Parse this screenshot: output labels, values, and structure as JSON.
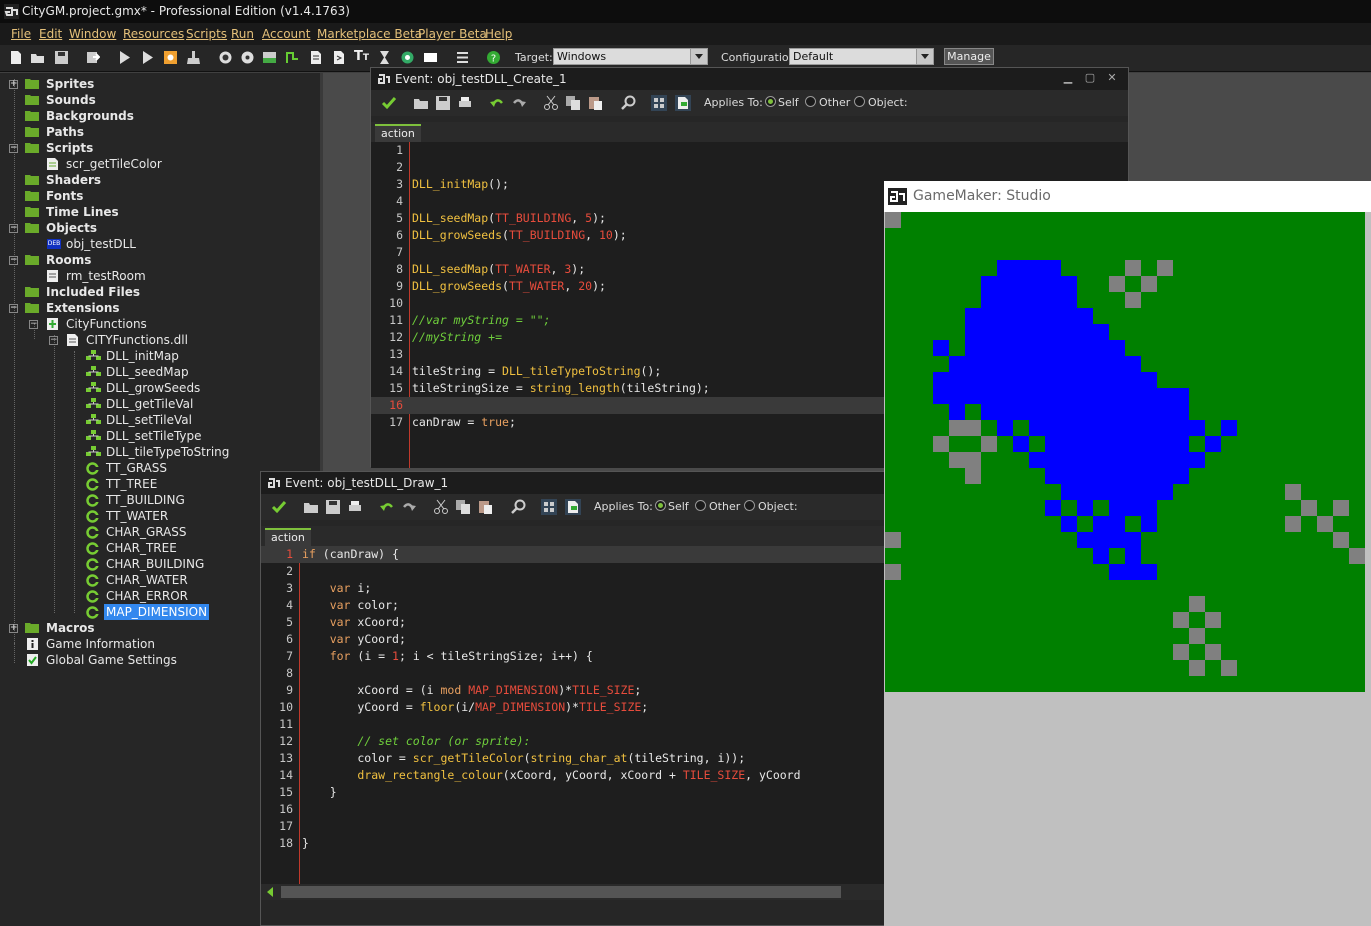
{
  "window": {
    "title": "CityGM.project.gmx*  -  Professional Edition (v1.4.1763)"
  },
  "menu": [
    "File",
    "Edit",
    "Window",
    "Resources",
    "Scripts",
    "Run",
    "Account",
    "Marketplace Beta",
    "Player Beta",
    "Help"
  ],
  "toolbar": {
    "target_label": "Target:",
    "target_value": "Windows",
    "config_label": "Configuration:",
    "config_value": "Default",
    "manage_label": "Manage"
  },
  "tree": {
    "sprites": "Sprites",
    "sounds": "Sounds",
    "backgrounds": "Backgrounds",
    "paths": "Paths",
    "scripts": "Scripts",
    "script_1": "scr_getTileColor",
    "shaders": "Shaders",
    "fonts": "Fonts",
    "timelines": "Time Lines",
    "objects": "Objects",
    "object_1": "obj_testDLL",
    "rooms": "Rooms",
    "room_1": "rm_testRoom",
    "included": "Included Files",
    "extensions": "Extensions",
    "ext_1": "CityFunctions",
    "dll": "CITYFunctions.dll",
    "functions": [
      "DLL_initMap",
      "DLL_seedMap",
      "DLL_growSeeds",
      "DLL_getTileVal",
      "DLL_setTileVal",
      "DLL_setTileType",
      "DLL_tileTypeToString"
    ],
    "constants": [
      "TT_GRASS",
      "TT_TREE",
      "TT_BUILDING",
      "TT_WATER",
      "CHAR_GRASS",
      "CHAR_TREE",
      "CHAR_BUILDING",
      "CHAR_WATER",
      "CHAR_ERROR",
      "MAP_DIMENSION"
    ],
    "macros": "Macros",
    "game_info": "Game Information",
    "global_settings": "Global Game Settings"
  },
  "create_event": {
    "title": "Event: obj_testDLL_Create_1",
    "applies_to": "Applies To:",
    "self": "Self",
    "other": "Other",
    "object": "Object:",
    "tab": "action",
    "current_line": 16
  },
  "draw_event": {
    "title": "Event: obj_testDLL_Draw_1",
    "applies_to": "Applies To:",
    "self": "Self",
    "other": "Other",
    "object": "Object:",
    "tab": "action",
    "current_line": 1
  },
  "game_window": {
    "title": "GameMaker: Studio",
    "colors": {
      "grass": "#008000",
      "water": "#0000ff",
      "building": "#808080"
    },
    "map_dimension": 30,
    "water_rows": [
      [],
      [],
      [],
      [
        7,
        8,
        9,
        10
      ],
      [
        6,
        7,
        8,
        9,
        10,
        11
      ],
      [
        6,
        7,
        8,
        9,
        10,
        11
      ],
      [
        5,
        6,
        7,
        8,
        9,
        10,
        11,
        12
      ],
      [
        5,
        6,
        7,
        8,
        9,
        10,
        11,
        12,
        13
      ],
      [
        3,
        5,
        6,
        7,
        8,
        9,
        10,
        11,
        12,
        13,
        14
      ],
      [
        4,
        5,
        6,
        7,
        8,
        9,
        10,
        11,
        12,
        13,
        14,
        15
      ],
      [
        3,
        4,
        5,
        6,
        7,
        8,
        9,
        10,
        11,
        12,
        13,
        14,
        15,
        16
      ],
      [
        3,
        4,
        5,
        6,
        7,
        8,
        9,
        10,
        11,
        12,
        13,
        14,
        15,
        16,
        17,
        18
      ],
      [
        4,
        6,
        7,
        8,
        9,
        10,
        11,
        12,
        13,
        14,
        15,
        16,
        17,
        18
      ],
      [
        5,
        7,
        9,
        10,
        11,
        12,
        13,
        14,
        15,
        16,
        17,
        18,
        19,
        21
      ],
      [
        8,
        10,
        11,
        12,
        13,
        14,
        15,
        16,
        17,
        18,
        20
      ],
      [
        9,
        10,
        11,
        12,
        13,
        14,
        15,
        16,
        17,
        18,
        19
      ],
      [
        10,
        11,
        12,
        13,
        14,
        15,
        16,
        17,
        18
      ],
      [
        11,
        12,
        13,
        14,
        15,
        16,
        17
      ],
      [
        10,
        12,
        14,
        15,
        16
      ],
      [
        11,
        13,
        14,
        16
      ],
      [
        12,
        13,
        14,
        15
      ],
      [
        13,
        15
      ],
      [
        14,
        15,
        16
      ]
    ],
    "building_rows": [
      [
        0
      ],
      [],
      [],
      [
        15,
        17
      ],
      [
        14,
        16
      ],
      [
        15
      ],
      [],
      [],
      [],
      [],
      [],
      [],
      [],
      [
        4,
        5
      ],
      [
        3,
        6
      ],
      [
        4,
        5
      ],
      [
        5
      ],
      [
        25
      ],
      [
        26,
        28
      ],
      [
        25,
        27
      ],
      [
        0,
        28
      ],
      [
        29
      ],
      [
        0
      ],
      [],
      [
        19
      ],
      [
        18,
        20
      ],
      [
        19
      ],
      [
        18,
        20
      ],
      [
        19,
        21
      ]
    ]
  }
}
